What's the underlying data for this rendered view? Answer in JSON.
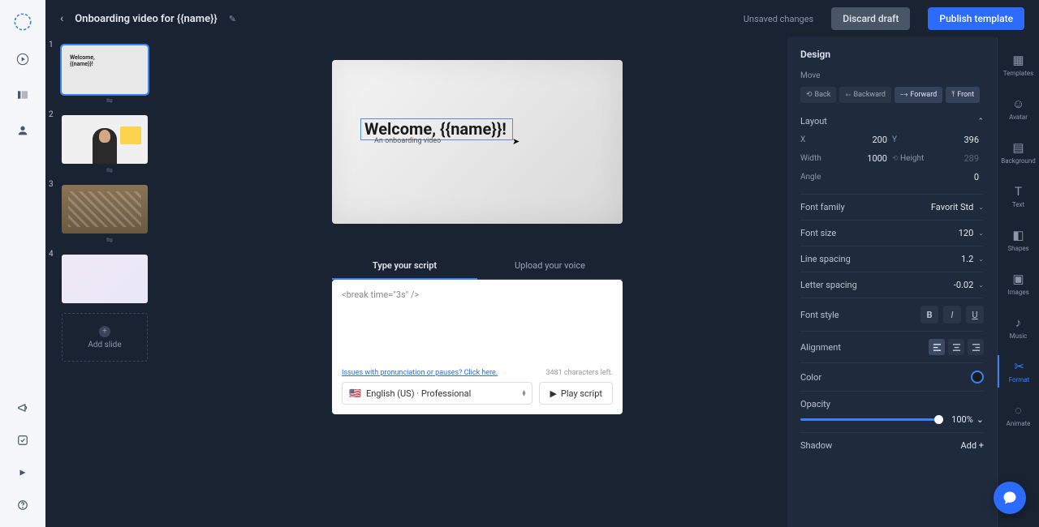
{
  "header": {
    "title": "Onboarding video for {{name}}",
    "unsaved": "Unsaved changes",
    "discard": "Discard draft",
    "publish": "Publish template"
  },
  "slides": {
    "items": [
      {
        "num": "1",
        "thumb_text": "Welcome,\n{{name}}!"
      },
      {
        "num": "2"
      },
      {
        "num": "3"
      },
      {
        "num": "4"
      }
    ],
    "add_label": "Add slide"
  },
  "canvas": {
    "main_text": "Welcome, {{name}}!",
    "sub_text": "An onboarding video"
  },
  "script": {
    "tab_type": "Type your script",
    "tab_upload": "Upload your voice",
    "body": "<break time=\"3s\" />",
    "help_link": "Issues with pronunciation or pauses? Click here.",
    "chars_left": "3481 characters left.",
    "language": "English (US) · Professional",
    "play": "Play script"
  },
  "design": {
    "title": "Design",
    "move": {
      "label": "Move",
      "back": "Back",
      "backward": "Backward",
      "forward": "Forward",
      "front": "Front"
    },
    "layout": {
      "label": "Layout",
      "x_lbl": "X",
      "x_val": "200",
      "y_lbl": "Y",
      "y_val": "396",
      "w_lbl": "Width",
      "w_val": "1000",
      "h_lbl": "Height",
      "h_val": "289",
      "a_lbl": "Angle",
      "a_val": "0"
    },
    "font_family": {
      "label": "Font family",
      "value": "Favorit Std"
    },
    "font_size": {
      "label": "Font size",
      "value": "120"
    },
    "line_spacing": {
      "label": "Line spacing",
      "value": "1.2"
    },
    "letter_spacing": {
      "label": "Letter spacing",
      "value": "-0.02"
    },
    "font_style": {
      "label": "Font style",
      "b": "B",
      "i": "I",
      "u": "U"
    },
    "alignment": {
      "label": "Alignment"
    },
    "color": {
      "label": "Color"
    },
    "opacity": {
      "label": "Opacity",
      "value": "100%"
    },
    "shadow": {
      "label": "Shadow",
      "value": "Add +"
    }
  },
  "right_rail": {
    "templates": "Templates",
    "avatar": "Avatar",
    "background": "Background",
    "text": "Text",
    "shapes": "Shapes",
    "images": "Images",
    "music": "Music",
    "format": "Format",
    "animate": "Animate"
  }
}
